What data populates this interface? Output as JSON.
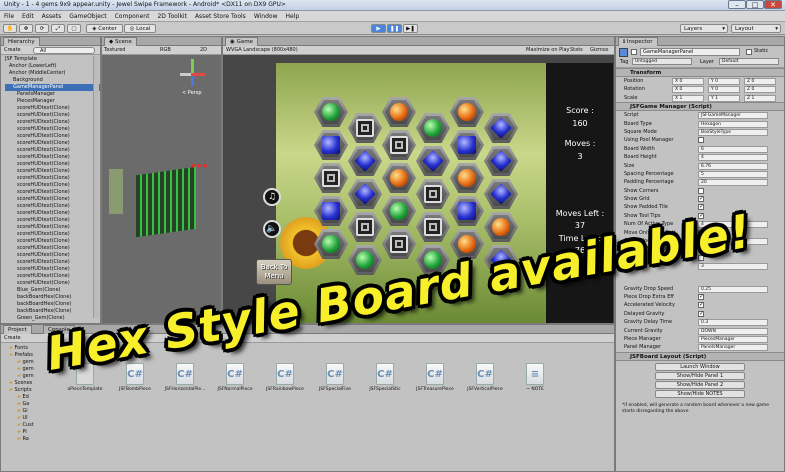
{
  "window": {
    "title": "Unity - 1 - 4 gems 9x9 appear.unity - Jewel Swipe Framework - Android* <DX11 on DX9 GPU>"
  },
  "menu": [
    "File",
    "Edit",
    "Assets",
    "GameObject",
    "Component",
    "2D Toolkit",
    "Asset Store Tools",
    "Window",
    "Help"
  ],
  "toolbar": {
    "center": "Center",
    "local": "Local",
    "layers": "Layers",
    "layout": "Layout"
  },
  "hierarchy": {
    "tab": "Hierarchy",
    "create": "Create",
    "search": "All",
    "items": [
      "JSF Template",
      "Anchor (LowerLeft)",
      "Anchor (MiddleCenter)",
      "Background",
      "GameManagerPanel",
      "PanelsManager",
      "PiecesManager",
      "scoreHUDtext(Clone)",
      "scoreHUDtext(Clone)",
      "scoreHUDtext(Clone)",
      "scoreHUDtext(Clone)",
      "scoreHUDtext(Clone)",
      "scoreHUDtext(Clone)",
      "scoreHUDtext(Clone)",
      "scoreHUDtext(Clone)",
      "scoreHUDtext(Clone)",
      "scoreHUDtext(Clone)",
      "scoreHUDtext(Clone)",
      "scoreHUDtext(Clone)",
      "scoreHUDtext(Clone)",
      "scoreHUDtext(Clone)",
      "scoreHUDtext(Clone)",
      "scoreHUDtext(Clone)",
      "scoreHUDtext(Clone)",
      "scoreHUDtext(Clone)",
      "scoreHUDtext(Clone)",
      "scoreHUDtext(Clone)",
      "scoreHUDtext(Clone)",
      "scoreHUDtext(Clone)",
      "scoreHUDtext(Clone)",
      "scoreHUDtext(Clone)",
      "scoreHUDtext(Clone)",
      "scoreHUDtext(Clone)",
      "Blue_Gem(Clone)",
      "backBoardHex(Clone)",
      "backBoardHex(Clone)",
      "backBoardHex(Clone)",
      "Green_Gem(Clone)"
    ]
  },
  "scene": {
    "tab": "Scene",
    "textured": "Textured",
    "rgb": "RGB",
    "mode2d": "2D",
    "persp": "< Persp"
  },
  "game": {
    "tab": "Game",
    "resolution": "WVGA Landscape (800x480)",
    "maximize": "Maximize on Play",
    "stats": "Stats",
    "gizmos": "Gizmos",
    "score_label": "Score :",
    "score": "160",
    "moves_label": "Moves :",
    "moves": "3",
    "moves_left_label": "Moves Left :",
    "moves_left": "37",
    "time_left_label": "Time Left :",
    "time_left": "76",
    "back_button": "Back To Menu"
  },
  "project": {
    "tab": "Project",
    "console_tab": "Console",
    "create": "Create",
    "folders": [
      "Fonts",
      "Prefabs",
      "gem",
      "gem",
      "gem",
      "Scenes",
      "Scripts",
      "Ed",
      "Ga",
      "Gi",
      "UI",
      "Cust",
      "Pi",
      "Ra"
    ],
    "assets": [
      "aPieceTemplate",
      "JSFBombPiece",
      "JSFHorizontalPie...",
      "JSFNormalPiece",
      "JSFRainbowPiece",
      "JSFSpecialFive",
      "JSFSpecialStic",
      "JSFTreasurePiece",
      "JSFVerticalPiece",
      "~ NOTE"
    ]
  },
  "inspector": {
    "tab": "Inspector",
    "name": "GameManagerPanel",
    "static": "Static",
    "tag_label": "Tag",
    "tag": "Untagged",
    "layer_label": "Layer",
    "layer": "Default",
    "transform": "Transform",
    "transform_rows": [
      {
        "label": "Position",
        "x": "X 0",
        "y": "Y 0",
        "z": "Z 0"
      },
      {
        "label": "Rotation",
        "x": "X 0",
        "y": "Y 0",
        "z": "Z 0"
      },
      {
        "label": "Scale",
        "x": "X 1",
        "y": "Y 1",
        "z": "Z 1"
      }
    ],
    "component": "JSFGame Manager (Script)",
    "rows": [
      {
        "label": "Script",
        "value": "JSFGameManager"
      },
      {
        "label": "Board Type",
        "value": "Hexagon"
      },
      {
        "label": "Square Mode",
        "value": "BoxStyleType"
      },
      {
        "label": "Using Pool Manager",
        "check": false
      },
      {
        "label": "Board Width",
        "value": "6"
      },
      {
        "label": "Board Height",
        "value": "4"
      },
      {
        "label": "Size",
        "value": "6.76"
      },
      {
        "label": "Spacing Percentage",
        "value": "5"
      },
      {
        "label": "Padding Percentage",
        "value": "20"
      },
      {
        "label": "Show Corners",
        "check": false
      },
      {
        "label": "Show Grid",
        "check": true
      },
      {
        "label": "Show Padded Tile",
        "check": true
      },
      {
        "label": "Show Tool Tips",
        "check": true
      },
      {
        "label": "Num Of Active Type",
        "value": "4"
      },
      {
        "label": "Move Only After Sett",
        "check": false
      },
      {
        "label": "Game Update Speed",
        "value": "0.2"
      },
      {
        "label": "No More Move Reset",
        "check": false
      },
      {
        "label": "Suggest",
        "check": false
      },
      {
        "label": "Sw",
        "value": "3"
      }
    ],
    "rows2": [
      {
        "label": "Gravity Drop Speed",
        "value": "0.25"
      },
      {
        "label": "Piece Drop Extra Eff",
        "check": true
      },
      {
        "label": "Accelerated Velocity",
        "check": true
      },
      {
        "label": "Delayed Gravity",
        "check": true
      },
      {
        "label": "Gravity Delay Time",
        "value": "0.3"
      },
      {
        "label": "Current Gravity",
        "value": "DOWN"
      },
      {
        "label": "Piece Manager",
        "value": "PiecesManager"
      },
      {
        "label": "Panel Manager",
        "value": "PanelsManager"
      }
    ],
    "layout_component": "JSFBoard Layout (Script)",
    "buttons": [
      "Launch Window",
      "Show/Hide Panel 1",
      "Show/Hide Panel 2",
      "Show/Hide NOTES"
    ],
    "note": "*if enabled, will generate a random board whenever a new game starts disregarding the above"
  },
  "banner": "Hex Style Board available!",
  "board": {
    "gems": [
      [
        "green",
        "block",
        "orange",
        "green",
        "orange",
        "blue"
      ],
      [
        "blue",
        "blue",
        "block",
        "blue",
        "blue",
        "blue"
      ],
      [
        "block",
        "blue",
        "orange",
        "block",
        "orange",
        "blue"
      ],
      [
        "blue",
        "block",
        "green",
        "block",
        "blue",
        "orange"
      ],
      [
        "green",
        "green",
        "block",
        "green",
        "orange",
        "blue"
      ]
    ]
  }
}
